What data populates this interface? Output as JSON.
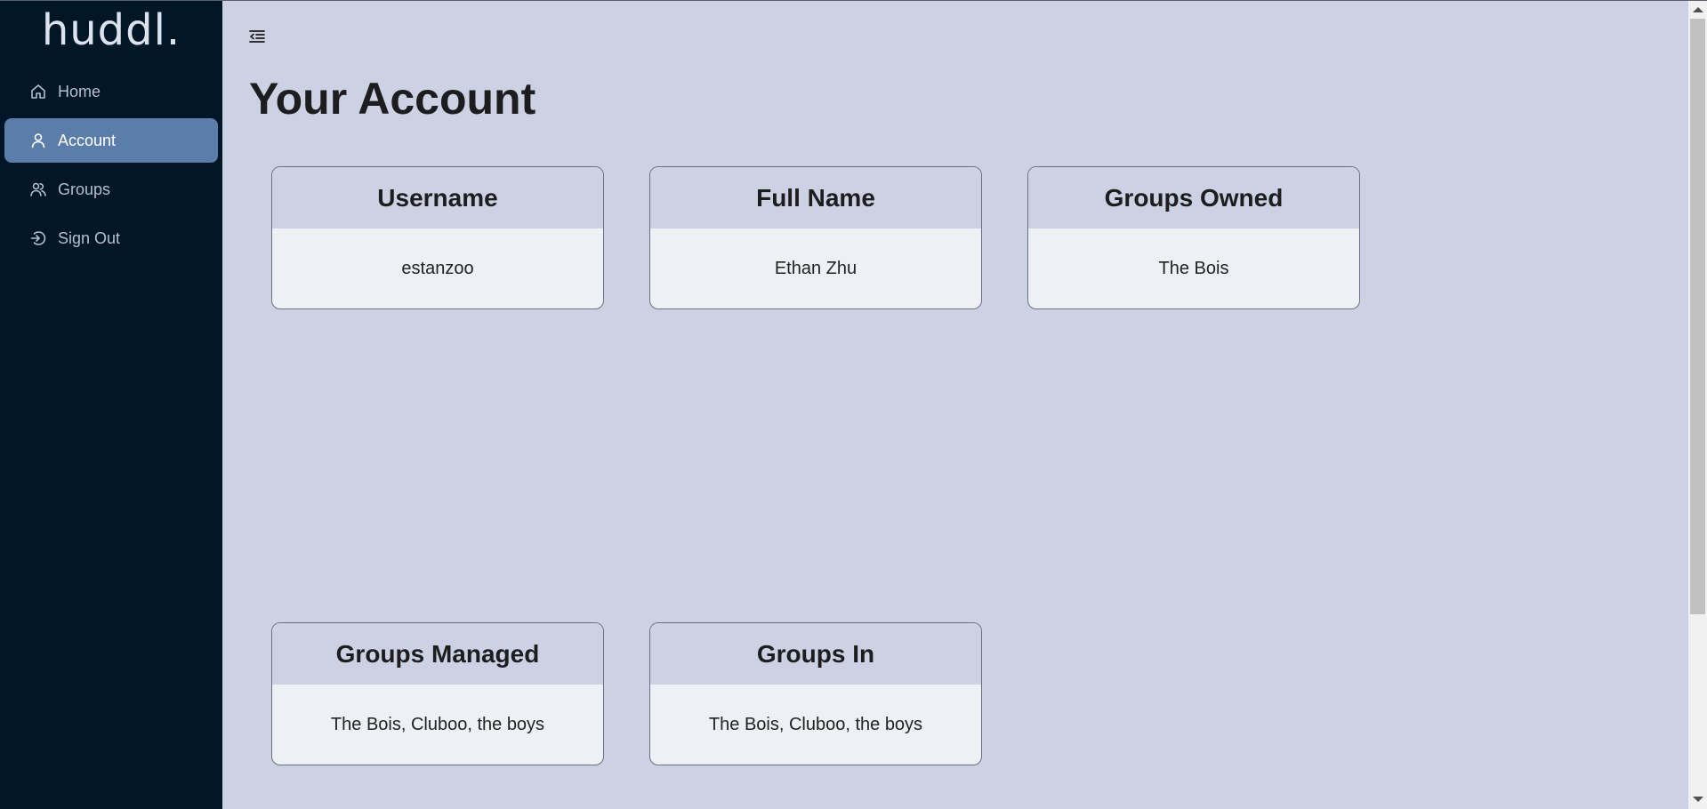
{
  "app": {
    "logo": "huddl."
  },
  "sidebar": {
    "items": [
      {
        "label": "Home",
        "icon": "home-icon",
        "active": false
      },
      {
        "label": "Account",
        "icon": "user-icon",
        "active": true
      },
      {
        "label": "Groups",
        "icon": "users-icon",
        "active": false
      },
      {
        "label": "Sign Out",
        "icon": "sign-out-icon",
        "active": false
      }
    ]
  },
  "header": {
    "toggle_icon": "sidebar-collapse-icon"
  },
  "main": {
    "title": "Your Account",
    "cards": [
      {
        "title": "Username",
        "value": "estanzoo"
      },
      {
        "title": "Full Name",
        "value": "Ethan Zhu"
      },
      {
        "title": "Groups Owned",
        "value": "The Bois"
      },
      {
        "title": "Groups Managed",
        "value": "The Bois, Cluboo, the boys"
      },
      {
        "title": "Groups In",
        "value": "The Bois, Cluboo, the boys"
      }
    ]
  },
  "colors": {
    "sidebar_bg": "#011627",
    "active_item": "#5b7daa",
    "page_bg": "#ccd2e3",
    "card_body": "#edf0f5"
  }
}
